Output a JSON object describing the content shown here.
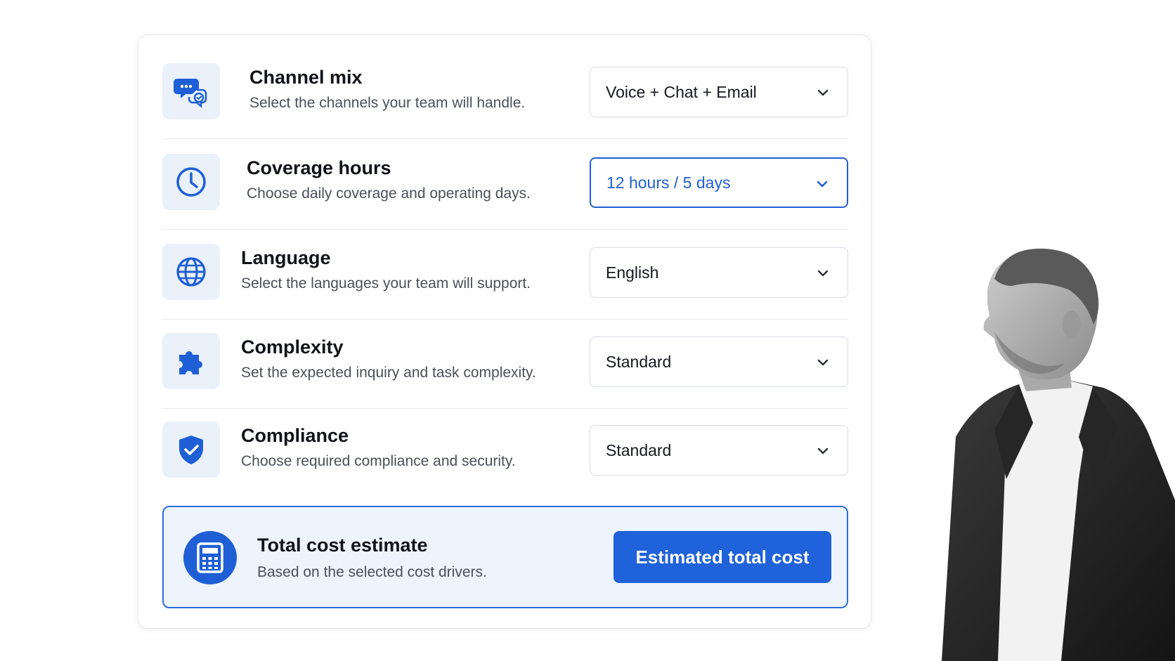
{
  "accent_color": "#1f5fd6",
  "rows": [
    {
      "icon": "chat-bubbles-icon",
      "title": "Channel mix",
      "description": "Select the channels your team will handle.",
      "value": "Voice + Chat + Email"
    },
    {
      "icon": "clock-icon",
      "title": "Coverage hours",
      "description": "Choose daily coverage and operating days.",
      "value": "12 hours / 5 days"
    },
    {
      "icon": "globe-icon",
      "title": "Language",
      "description": "Select the languages your team will support.",
      "value": "English"
    },
    {
      "icon": "puzzle-icon",
      "title": "Complexity",
      "description": "Set the expected inquiry and task complexity.",
      "value": "Standard"
    },
    {
      "icon": "shield-check-icon",
      "title": "Compliance",
      "description": "Choose required compliance and security.",
      "value": "Standard"
    }
  ],
  "summary": {
    "icon": "calculator-icon",
    "title": "Total cost estimate",
    "description": "Based on the selected cost drivers.",
    "button_label": "Estimated total cost"
  },
  "photo": {
    "icon": "person-photo"
  }
}
